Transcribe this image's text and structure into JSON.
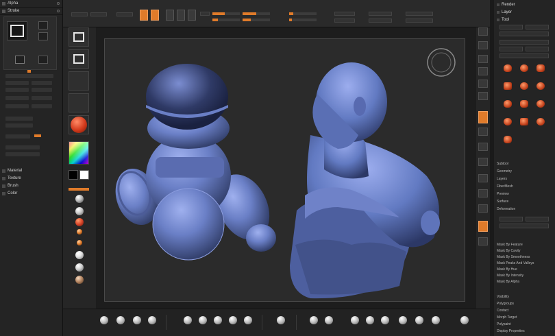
{
  "left_panel": {
    "header_1": "Alpha",
    "header_2": "Stroke",
    "sub_headers": [
      "Material",
      "Texture",
      "Brush",
      "Color"
    ]
  },
  "top_toolbar": {
    "label": ""
  },
  "canvas": {
    "background": "#2b2b2b",
    "model_color": "#6a7fc6",
    "models": [
      "mannequin-ball-figure",
      "bust-sculpt"
    ]
  },
  "right_panel": {
    "headers": [
      "Render",
      "Layer",
      "Tool"
    ],
    "subtool_items": [
      "Subtool",
      "Geometry",
      "Layers",
      "FiberMesh",
      "Preview",
      "Surface",
      "Deformation"
    ],
    "mask_items": [
      "Mask By Feature",
      "Mask By Cavity",
      "Mask By Smoothness",
      "Mask Peaks And Valleys",
      "Mask By Hue",
      "Mask By Intensity",
      "Mask By Alpha"
    ],
    "bottom_items": [
      "Visibility",
      "Polygroups",
      "Contact",
      "Morph Target",
      "Polypaint",
      "Display Properties"
    ]
  },
  "colors": {
    "accent": "#e07b2a",
    "model_blue": "#6a7fc6",
    "panel": "#242424",
    "viewport": "#2b2b2b"
  },
  "icons": {
    "tool_grid": "tool-thumbnail-icon",
    "bottom_brushes": "brush-sphere-icon"
  }
}
